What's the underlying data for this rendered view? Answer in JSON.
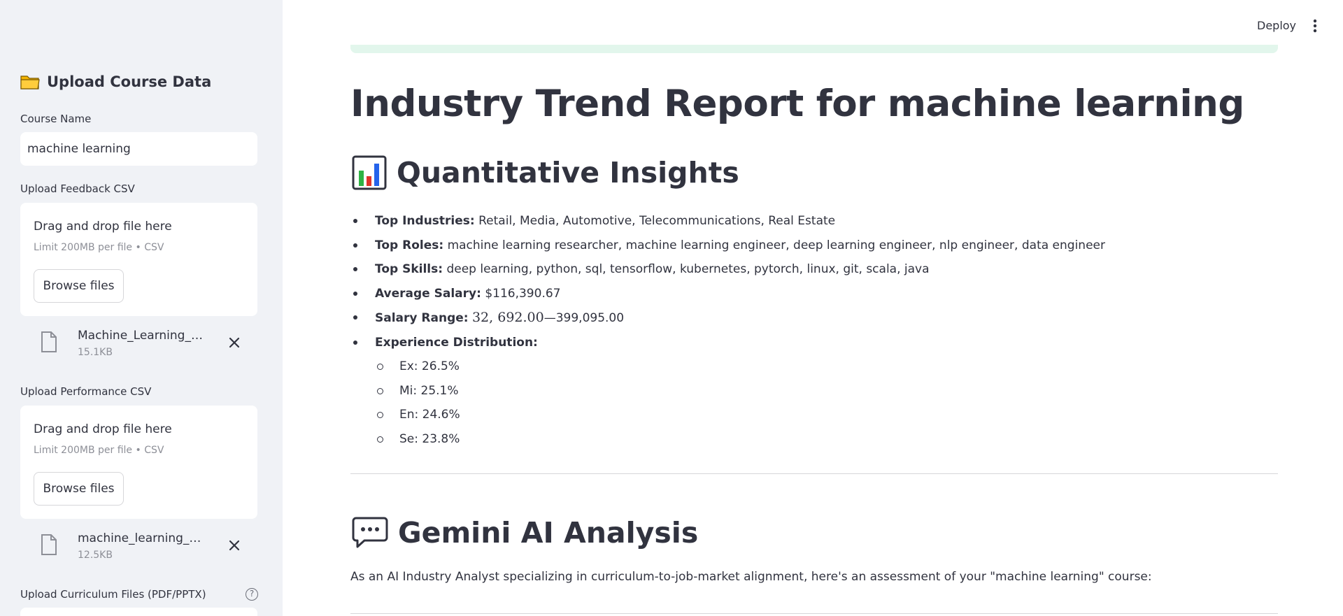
{
  "sidebar": {
    "header": "Upload Course Data",
    "course_name_label": "Course Name",
    "course_name_value": "machine learning",
    "feedback": {
      "label": "Upload Feedback CSV",
      "drop_title": "Drag and drop file here",
      "drop_sub": "Limit 200MB per file • CSV",
      "browse_label": "Browse files",
      "file_name": "Machine_Learning_feed…",
      "file_size": "15.1KB"
    },
    "performance": {
      "label": "Upload Performance CSV",
      "drop_title": "Drag and drop file here",
      "drop_sub": "Limit 200MB per file • CSV",
      "browse_label": "Browse files",
      "file_name": "machine_learning_perf…",
      "file_size": "12.5KB"
    },
    "curriculum_label": "Upload Curriculum Files (PDF/PPTX)",
    "help_glyph": "?"
  },
  "topbar": {
    "deploy_label": "Deploy"
  },
  "main": {
    "title": "Industry Trend Report for machine learning",
    "quant_heading": "Quantitative Insights",
    "insights": {
      "industries_label": "Top Industries:",
      "industries_value": "Retail, Media, Automotive, Telecommunications, Real Estate",
      "roles_label": "Top Roles:",
      "roles_value": "machine learning researcher, machine learning engineer, deep learning engineer, nlp engineer, data engineer",
      "skills_label": "Top Skills:",
      "skills_value": "deep learning, python, sql, tensorflow, kubernetes, pytorch, linux, git, scala, java",
      "avg_salary_label": "Average Salary:",
      "avg_salary_value": "$116,390.67",
      "salary_range_label": "Salary Range:",
      "salary_range_math": "32, 692.00",
      "salary_range_rest": "—399,095.00",
      "experience_label": "Experience Distribution:",
      "experience": [
        "Ex: 26.5%",
        "Mi: 25.1%",
        "En: 24.6%",
        "Se: 23.8%"
      ]
    },
    "gemini_heading": "Gemini AI Analysis",
    "gemini_intro": "As an AI Industry Analyst specializing in curriculum-to-job-market alignment, here's an assessment of your \"machine learning\" course:"
  },
  "colors": {
    "sidebar_bg": "#f0f2f6",
    "text": "#31333f",
    "muted": "#8d8f97",
    "success_strip": "#e2f6ec"
  },
  "icons": [
    "folder-icon",
    "file-icon",
    "close-icon",
    "help-icon",
    "kebab-menu-icon",
    "bar-chart-icon",
    "speech-bubble-icon"
  ]
}
